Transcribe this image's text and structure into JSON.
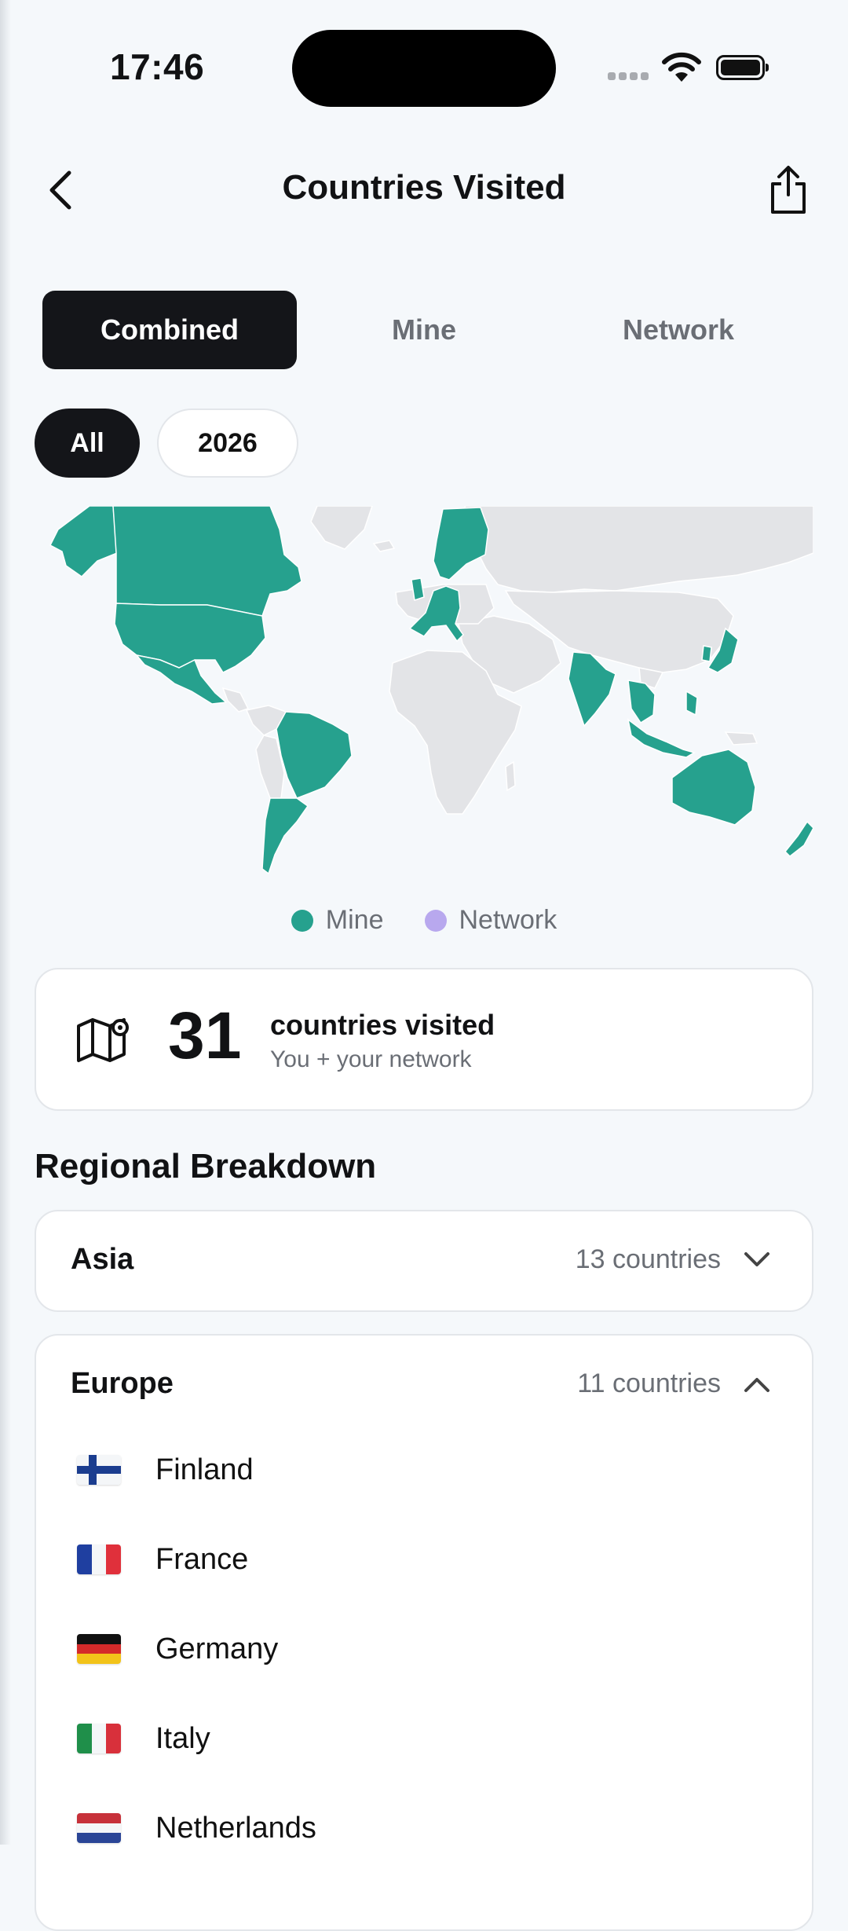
{
  "status": {
    "time": "17:46"
  },
  "header": {
    "title": "Countries Visited"
  },
  "tabs": [
    {
      "label": "Combined",
      "active": true
    },
    {
      "label": "Mine",
      "active": false
    },
    {
      "label": "Network",
      "active": false
    }
  ],
  "filters": [
    {
      "label": "All",
      "active": true
    },
    {
      "label": "2026",
      "active": false
    }
  ],
  "legend": [
    {
      "label": "Mine",
      "color": "#26a18e"
    },
    {
      "label": "Network",
      "color": "#b8a8ee"
    }
  ],
  "colors": {
    "visited": "#26a18e",
    "unvisited": "#e3e4e7",
    "accent_dark": "#141519"
  },
  "summary": {
    "count": "31",
    "label": "countries visited",
    "subtitle": "You + your network"
  },
  "regions_title": "Regional Breakdown",
  "regions": [
    {
      "name": "Asia",
      "count": "13 countries",
      "expanded": false
    },
    {
      "name": "Europe",
      "count": "11 countries",
      "expanded": true,
      "countries": [
        {
          "name": "Finland"
        },
        {
          "name": "France"
        },
        {
          "name": "Germany"
        },
        {
          "name": "Italy"
        },
        {
          "name": "Netherlands"
        }
      ]
    }
  ]
}
